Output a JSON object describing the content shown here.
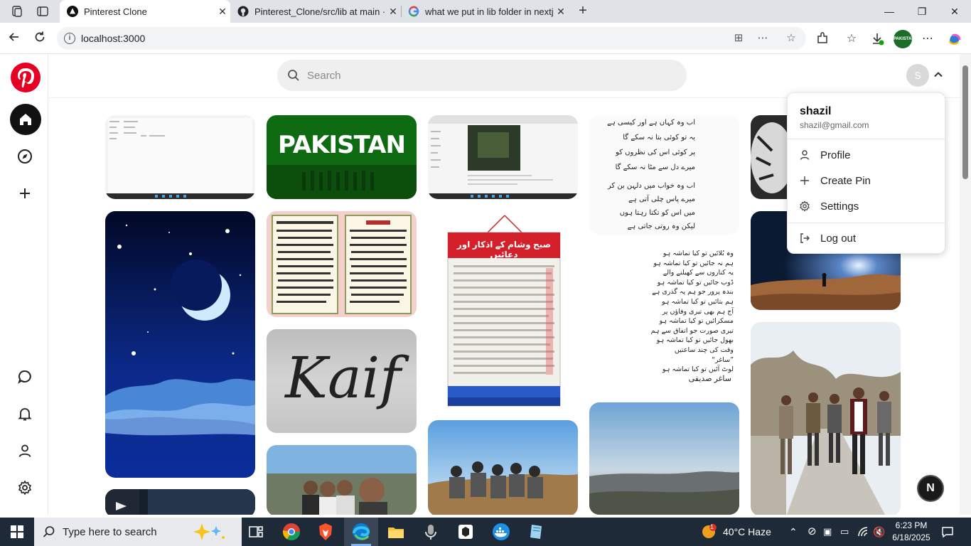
{
  "browser": {
    "tabs": [
      {
        "title": "Pinterest Clone",
        "active": true
      },
      {
        "title": "Pinterest_Clone/src/lib at main · N",
        "active": false
      },
      {
        "title": "what we put in lib folder in nextjs",
        "active": false
      }
    ],
    "url": "localhost:3000",
    "profile_badge": "PAKISTAN"
  },
  "search": {
    "placeholder": "Search"
  },
  "user": {
    "initial": "S",
    "name": "shazil",
    "email": "shazil@gmail.com"
  },
  "menu": {
    "profile": "Profile",
    "create_pin": "Create Pin",
    "settings": "Settings",
    "logout": "Log out"
  },
  "pins": {
    "pakistan_text": "PAKISTAN",
    "kaif_text": "Kaif",
    "urdu_poem_top": [
      "اب وہ کہاں ہے اور کیسی ہے",
      "یہ تو کوئی بتا نہ سکے گا",
      "پر کوئی اس کی نظروں کو",
      "میرے دل سے مٹا نہ سکے گا"
    ],
    "urdu_poem_mid": [
      "اب وہ خواب میں دلہن بن کر",
      "میرے پاس چلی آتی ہے",
      "میں اس کو تکتا رہتا ہوں",
      "لیکن وہ روتی جاتی ہے"
    ],
    "urdu_poem_long": [
      "وہ بُلائیں تو کیا تماشہ ہو",
      "ہم نہ جائیں تو کیا تماشہ ہو",
      "یہ کناروں سے کھیلنے والے",
      "ڈوب جائیں تو کیا تماشہ ہو",
      "بندہ پرور جو ہم پہ گذری ہے",
      "ہم بتائیں تو کیا تماشہ ہو",
      "آج ہم بھی تیری وفاؤں پر",
      "مسکرائیں تو کیا تماشہ ہو",
      "تیری صورت جو اتفاق سے ہم",
      "بھول جائیں تو کیا تماشہ ہو",
      "وقت کی چند ساعتیں ”ساغر“",
      "لوٹ آئیں تو کیا تماشہ ہو"
    ],
    "poet": "ساغر صدیقی",
    "scroll_title": "صبح وشام کے اذکار اور دعائیں"
  },
  "fab": {
    "label": "N"
  },
  "taskbar": {
    "search_placeholder": "Type here to search",
    "weather": "40°C  Haze",
    "weather_badge": "1",
    "time": "6:23 PM",
    "date": "6/18/2025"
  },
  "colors": {
    "pinterest_red": "#e60023",
    "page_bg": "#ffffff",
    "taskbar": "#1f2a38"
  }
}
